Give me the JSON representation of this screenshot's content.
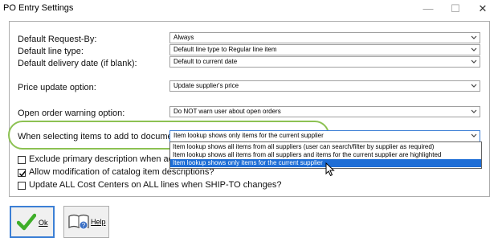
{
  "window": {
    "title": "PO Entry Settings",
    "minimize": "—",
    "maximize": "☐",
    "close": "✕"
  },
  "settings": {
    "request_by": {
      "label": "Default Request-By:",
      "value": "Always"
    },
    "line_type": {
      "label": "Default line type:",
      "value": "Default line type to Regular line item"
    },
    "delivery_date": {
      "label": "Default delivery date (if blank):",
      "value": "Default to current date"
    },
    "price_update": {
      "label": "Price update option:",
      "value": "Update supplier's price"
    },
    "open_order": {
      "label": "Open order warning option:",
      "value": "Do NOT warn user about open orders"
    },
    "select_items": {
      "label": "When selecting items to add to document:",
      "value": "Item lookup shows only items for the current supplier"
    }
  },
  "dropdown": {
    "options": [
      "Item lookup shows all items from all suppliers (user can search/filter by supplier as required)",
      "Item lookup shows all items from all suppliers and items for the current supplier are highlighted",
      "Item lookup shows only items for the current supplier"
    ],
    "selected_index": 2
  },
  "checkboxes": [
    {
      "label": "Exclude primary description when additi",
      "checked": false
    },
    {
      "label": "Allow modification of catalog item descriptions?",
      "checked": true
    },
    {
      "label": "Update ALL Cost Centers on ALL lines when SHIP-TO changes?",
      "checked": false
    }
  ],
  "buttons": {
    "ok": "Ok",
    "help": "Help"
  },
  "colors": {
    "accent": "#3c7fd5",
    "highlight_ring": "#8cc152",
    "selection": "#1e6ed6",
    "check_green": "#3fae29"
  }
}
